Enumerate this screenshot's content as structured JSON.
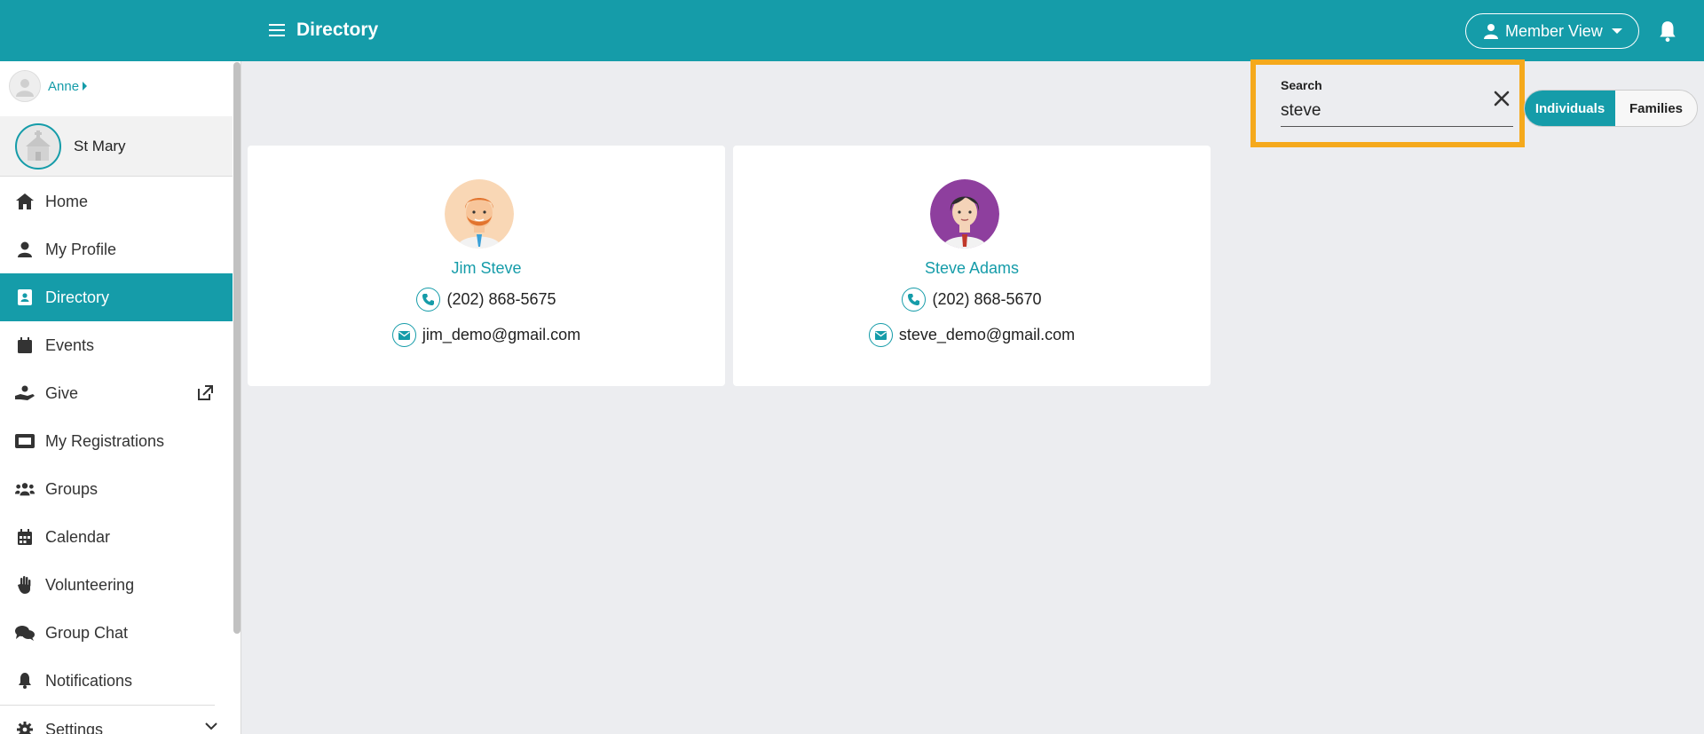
{
  "header": {
    "title": "Directory",
    "member_view_label": "Member View"
  },
  "sidebar": {
    "user_name": "Anne",
    "church_name": "St Mary",
    "items": [
      {
        "label": "Home",
        "icon": "home-icon"
      },
      {
        "label": "My Profile",
        "icon": "user-icon"
      },
      {
        "label": "Directory",
        "icon": "address-book-icon",
        "active": true
      },
      {
        "label": "Events",
        "icon": "calendar-icon"
      },
      {
        "label": "Give",
        "icon": "hand-holding-icon",
        "external": true
      },
      {
        "label": "My Registrations",
        "icon": "ticket-icon"
      },
      {
        "label": "Groups",
        "icon": "users-icon"
      },
      {
        "label": "Calendar",
        "icon": "calendar-grid-icon"
      },
      {
        "label": "Volunteering",
        "icon": "hand-icon"
      },
      {
        "label": "Group Chat",
        "icon": "comments-icon"
      },
      {
        "label": "Notifications",
        "icon": "bell-icon"
      },
      {
        "label": "Settings",
        "icon": "gear-icon",
        "expandable": true
      }
    ]
  },
  "search": {
    "label": "Search",
    "value": "steve"
  },
  "view_toggle": {
    "individuals": "Individuals",
    "families": "Families",
    "selected": "Individuals"
  },
  "results": [
    {
      "name": "Jim Steve",
      "phone": "(202) 868-5675",
      "email": "jim_demo@gmail.com"
    },
    {
      "name": "Steve Adams",
      "phone": "(202) 868-5670",
      "email": "steve_demo@gmail.com"
    }
  ],
  "colors": {
    "brand": "#159ca9",
    "highlight": "#f5a91c"
  }
}
